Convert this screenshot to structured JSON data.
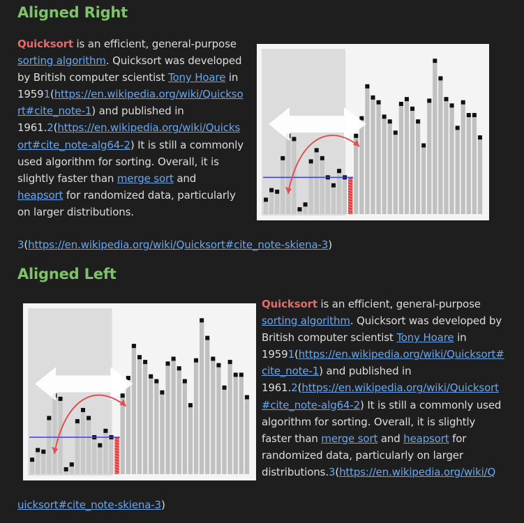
{
  "section_right": {
    "heading": "Aligned Right"
  },
  "section_left": {
    "heading": "Aligned Left"
  },
  "paragraph": {
    "term": "Quicksort",
    "t1": " is an efficient, general-purpose ",
    "link_sorting": "sorting algorithm",
    "t2": ". Quicksort was developed by British computer scientist ",
    "link_hoare": "Tony Hoare",
    "t3": " in 1959",
    "fn1": "1",
    "ref1": "https://en.wikipedia.org/wiki/Quicksort#cite_note-1",
    "t4": " and published in 1961.",
    "fn2": "2",
    "ref2": "https://en.wikipedia.org/wiki/Quicksort#cite_note-alg64-2",
    "t5": " It is still a commonly used algorithm for sorting. Overall, it is slightly faster than ",
    "link_merge": "merge sort",
    "t6": " and ",
    "link_heap": "heapsort",
    "t7": " for randomized data, particularly on larger distributions.",
    "fn3": "3",
    "ref3": "https://en.wikipedia.org/wiki/Quicksort#cite_note-skiena-3"
  },
  "figure": {
    "colors": {
      "bar": "#c8c8c8",
      "sorted_bar": "#c0c0c0",
      "point": "#111111",
      "pivot_line": "#3a3aff",
      "arc": "#e05050",
      "pivot_bar": "#e04040",
      "region": "#dcdcdc",
      "arrow": "#ffffff"
    },
    "bar_values": [
      0.09,
      0.15,
      0.14,
      0.35,
      0.49,
      0.47,
      0.03,
      0.06,
      0.33,
      0.4,
      0.35,
      0.23,
      0.18,
      0.27,
      0.23,
      0.23,
      0.49,
      0.6,
      0.8,
      0.73,
      0.7,
      0.61,
      0.58,
      0.51,
      0.69,
      0.72,
      0.66,
      0.58,
      0.43,
      0.71,
      0.96,
      0.85,
      0.72,
      0.68,
      0.54,
      0.7,
      0.62,
      0.62,
      0.48
    ],
    "point_offsets": [
      0.09,
      0.15,
      0.14,
      0.35,
      0.49,
      0.47,
      0.03,
      0.06,
      0.33,
      0.4,
      0.35,
      0.23,
      0.18,
      0.27,
      0.23,
      0.23,
      0.49,
      0.6,
      0.8,
      0.73,
      0.7,
      0.61,
      0.58,
      0.51,
      0.69,
      0.72,
      0.66,
      0.58,
      0.43,
      0.71,
      0.96,
      0.85,
      0.72,
      0.68,
      0.54,
      0.7,
      0.62,
      0.62,
      0.48
    ]
  }
}
